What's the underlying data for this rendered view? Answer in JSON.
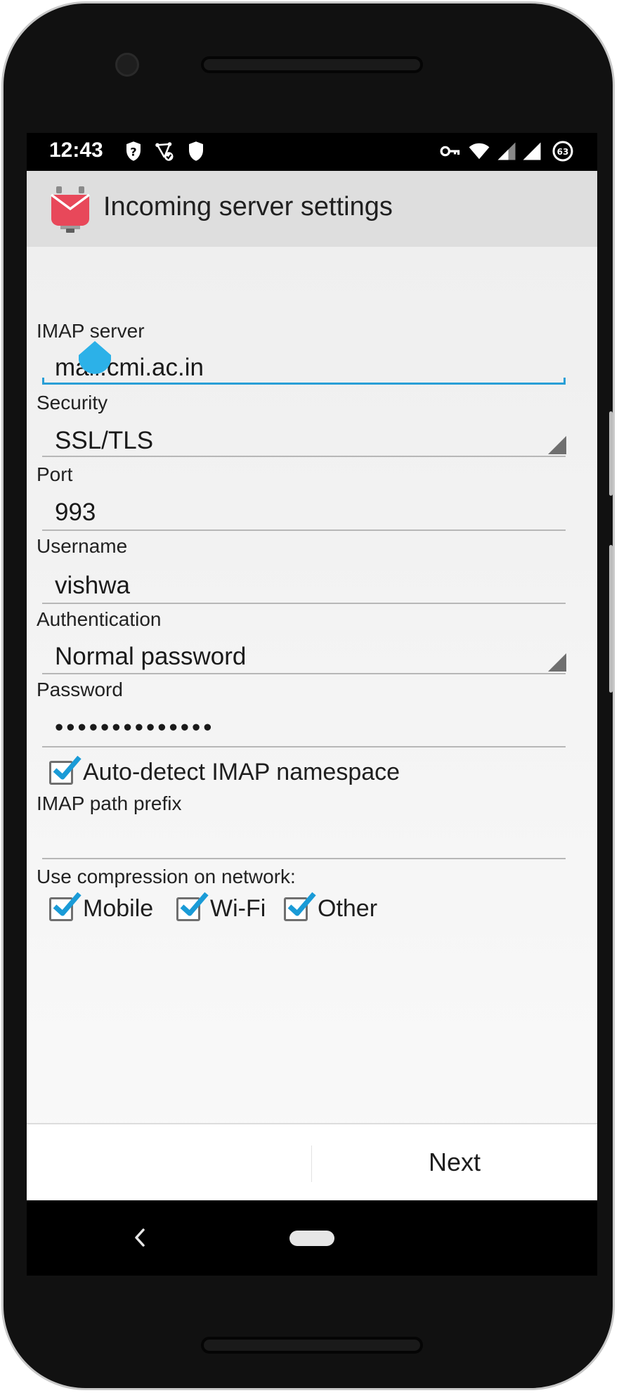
{
  "status_bar": {
    "time": "12:43",
    "left_icons": [
      "shield-question-icon",
      "network-check-icon",
      "shield-icon"
    ],
    "right_icons": [
      "vpn-key-icon",
      "wifi-icon",
      "signal-icon",
      "signal-full-icon",
      "battery-icon"
    ],
    "battery_level": "63"
  },
  "app_bar": {
    "title": "Incoming server settings"
  },
  "form": {
    "imap_server_label": "IMAP server",
    "imap_server_value": "mail.cmi.ac.in",
    "security_label": "Security",
    "security_value": "SSL/TLS",
    "port_label": "Port",
    "port_value": "993",
    "username_label": "Username",
    "username_value": "vishwa",
    "authentication_label": "Authentication",
    "authentication_value": "Normal password",
    "password_label": "Password",
    "password_value": "••••••••••••••",
    "auto_detect_label": "Auto-detect IMAP namespace",
    "auto_detect_checked": true,
    "path_prefix_label": "IMAP path prefix",
    "path_prefix_value": "",
    "compression_label": "Use compression on network:",
    "compression_options": [
      {
        "label": "Mobile",
        "checked": true
      },
      {
        "label": "Wi-Fi",
        "checked": true
      },
      {
        "label": "Other",
        "checked": true
      }
    ]
  },
  "footer": {
    "next_label": "Next"
  },
  "colors": {
    "accent": "#2a9fd6",
    "check": "#1a9bd7",
    "app_bar": "#dedede",
    "logo_red": "#e8485a"
  }
}
